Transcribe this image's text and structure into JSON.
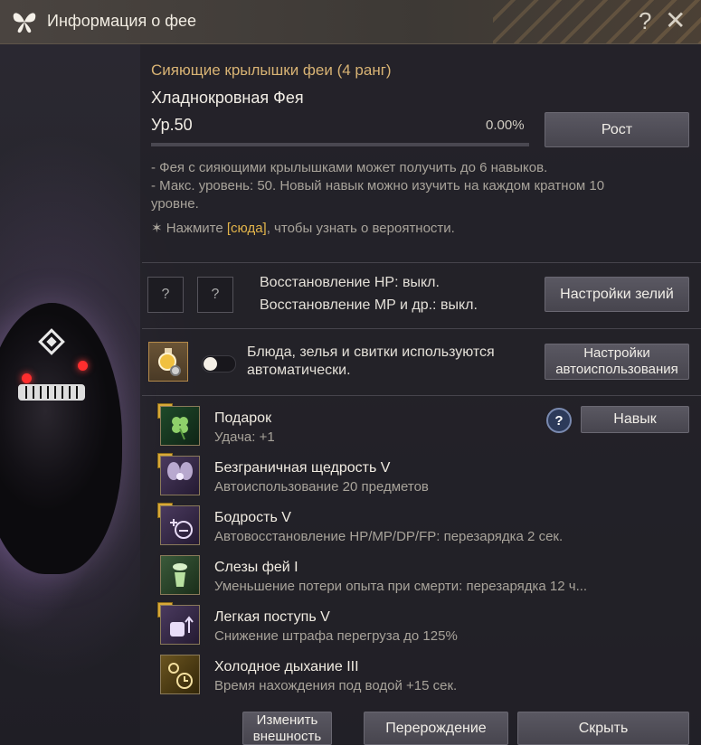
{
  "window": {
    "title": "Информация о фее",
    "help_glyph": "?",
    "close_glyph": "✕"
  },
  "fairy": {
    "rank_title": "Сияющие крылышки феи (4 ранг)",
    "name": "Хладнокровная Фея",
    "level": "Ур.50",
    "exp_percent": "0.00%",
    "exp_fraction": 0.0,
    "grow_button": "Рост"
  },
  "info": {
    "line1": "- Фея с сияющими крылышками может получить до 6 навыков.",
    "line2": "- Макс. уровень: 50. Новый навык можно изучить на каждом кратном 10",
    "line3": "уровне.",
    "hint_prefix": "✶ Нажмите ",
    "hint_link": "[сюда]",
    "hint_suffix": ", чтобы узнать о вероятности."
  },
  "potions": {
    "slot1": "?",
    "slot2": "?",
    "hp_recovery": "Восстановление HP: выкл.",
    "mp_recovery": "Восстановление MP и др.: выкл.",
    "settings_button": "Настройки зелий"
  },
  "auto_use": {
    "text": "Блюда, зелья и свитки используются автоматически.",
    "toggle_on": false,
    "settings_button": "Настройки автоиспользования"
  },
  "skills": [
    {
      "name": "Подарок",
      "desc": "Удача: +1",
      "badge": "M",
      "icon": "clover-icon"
    },
    {
      "name": "Безграничная щедрость V",
      "desc": "Автоиспользование 20 предметов",
      "badge": "M",
      "icon": "fairy-icon"
    },
    {
      "name": "Бодрость V",
      "desc": "Автовосстановление HP/MP/DP/FP: перезарядка 2 сек.",
      "badge": "M",
      "icon": "potion-plus-icon"
    },
    {
      "name": "Слезы фей I",
      "desc": "Уменьшение потери опыта при смерти: перезарядка 12 ч...",
      "badge": "",
      "icon": "tear-bottle-icon"
    },
    {
      "name": "Легкая поступь V",
      "desc": "Снижение штрафа перегруза до 125%",
      "badge": "M",
      "icon": "weight-icon"
    },
    {
      "name": "Холодное дыхание III",
      "desc": "Время нахождения под водой +15 сек.",
      "badge": "",
      "icon": "bubble-icon"
    }
  ],
  "skill_help_glyph": "?",
  "skill_button": "Навык",
  "footer": {
    "change_appearance_line1": "Изменить",
    "change_appearance_line2": "внешность",
    "rebirth": "Перерождение",
    "hide": "Скрыть"
  },
  "colors": {
    "accent_gold": "#d8b374",
    "link_gold": "#e2b44a",
    "badge_gold": "#d9a938"
  }
}
